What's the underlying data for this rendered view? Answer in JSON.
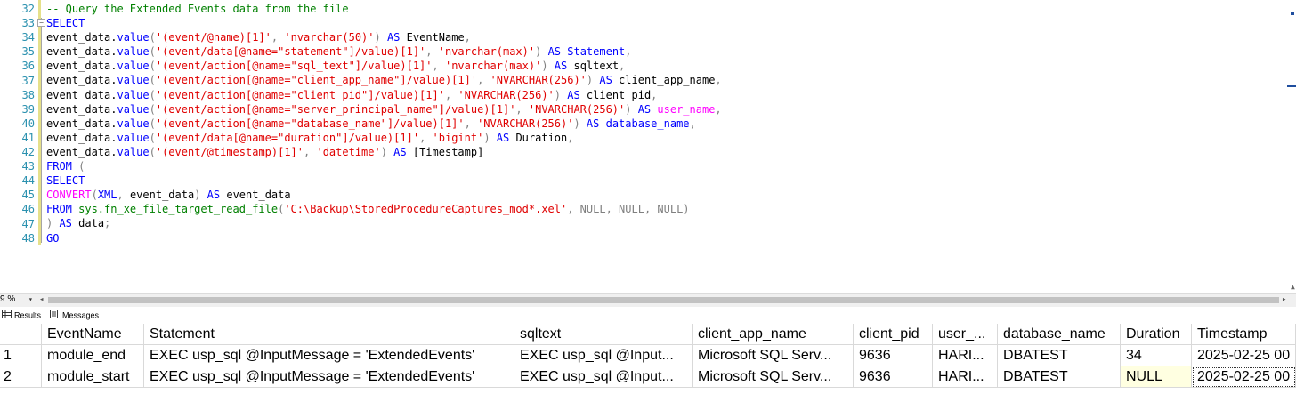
{
  "editor": {
    "line_numbers": [
      "32",
      "33",
      "34",
      "35",
      "36",
      "37",
      "38",
      "39",
      "40",
      "41",
      "42",
      "43",
      "44",
      "45",
      "46",
      "47",
      "48"
    ],
    "lines": [
      [
        {
          "t": "-- Query the Extended Events data from the file",
          "c": "cm"
        }
      ],
      [
        {
          "t": "SELECT",
          "c": "kw"
        }
      ],
      [
        {
          "t": "event_data.",
          "c": ""
        },
        {
          "t": "value",
          "c": "kw"
        },
        {
          "t": "(",
          "c": "gr"
        },
        {
          "t": "'(event/@name)[1]'",
          "c": "str"
        },
        {
          "t": ", ",
          "c": "gr"
        },
        {
          "t": "'nvarchar(50)'",
          "c": "str"
        },
        {
          "t": ")",
          "c": "gr"
        },
        {
          "t": " AS ",
          "c": "kw"
        },
        {
          "t": "EventName",
          "c": ""
        },
        {
          "t": ",",
          "c": "gr"
        }
      ],
      [
        {
          "t": "event_data.",
          "c": ""
        },
        {
          "t": "value",
          "c": "kw"
        },
        {
          "t": "(",
          "c": "gr"
        },
        {
          "t": "'(event/data[@name=\"statement\"]/value)[1]'",
          "c": "str"
        },
        {
          "t": ", ",
          "c": "gr"
        },
        {
          "t": "'nvarchar(max)'",
          "c": "str"
        },
        {
          "t": ")",
          "c": "gr"
        },
        {
          "t": " AS ",
          "c": "kw"
        },
        {
          "t": "Statement",
          "c": "kw"
        },
        {
          "t": ",",
          "c": "gr"
        }
      ],
      [
        {
          "t": "event_data.",
          "c": ""
        },
        {
          "t": "value",
          "c": "kw"
        },
        {
          "t": "(",
          "c": "gr"
        },
        {
          "t": "'(event/action[@name=\"sql_text\"]/value)[1]'",
          "c": "str"
        },
        {
          "t": ", ",
          "c": "gr"
        },
        {
          "t": "'nvarchar(max)'",
          "c": "str"
        },
        {
          "t": ")",
          "c": "gr"
        },
        {
          "t": " AS ",
          "c": "kw"
        },
        {
          "t": "sqltext",
          "c": ""
        },
        {
          "t": ",",
          "c": "gr"
        }
      ],
      [
        {
          "t": "event_data.",
          "c": ""
        },
        {
          "t": "value",
          "c": "kw"
        },
        {
          "t": "(",
          "c": "gr"
        },
        {
          "t": "'(event/action[@name=\"client_app_name\"]/value)[1]'",
          "c": "str"
        },
        {
          "t": ", ",
          "c": "gr"
        },
        {
          "t": "'NVARCHAR(256)'",
          "c": "str"
        },
        {
          "t": ")",
          "c": "gr"
        },
        {
          "t": " AS ",
          "c": "kw"
        },
        {
          "t": "client_app_name",
          "c": ""
        },
        {
          "t": ",",
          "c": "gr"
        }
      ],
      [
        {
          "t": "event_data.",
          "c": ""
        },
        {
          "t": "value",
          "c": "kw"
        },
        {
          "t": "(",
          "c": "gr"
        },
        {
          "t": "'(event/action[@name=\"client_pid\"]/value)[1]'",
          "c": "str"
        },
        {
          "t": ", ",
          "c": "gr"
        },
        {
          "t": "'NVARCHAR(256)'",
          "c": "str"
        },
        {
          "t": ")",
          "c": "gr"
        },
        {
          "t": " AS ",
          "c": "kw"
        },
        {
          "t": "client_pid",
          "c": ""
        },
        {
          "t": ",",
          "c": "gr"
        }
      ],
      [
        {
          "t": "event_data.",
          "c": ""
        },
        {
          "t": "value",
          "c": "kw"
        },
        {
          "t": "(",
          "c": "gr"
        },
        {
          "t": "'(event/action[@name=\"server_principal_name\"]/value)[1]'",
          "c": "str"
        },
        {
          "t": ", ",
          "c": "gr"
        },
        {
          "t": "'NVARCHAR(256)'",
          "c": "str"
        },
        {
          "t": ")",
          "c": "gr"
        },
        {
          "t": " AS ",
          "c": "kw"
        },
        {
          "t": "user_name",
          "c": "fn"
        },
        {
          "t": ",",
          "c": "gr"
        }
      ],
      [
        {
          "t": "event_data.",
          "c": ""
        },
        {
          "t": "value",
          "c": "kw"
        },
        {
          "t": "(",
          "c": "gr"
        },
        {
          "t": "'(event/action[@name=\"database_name\"]/value)[1]'",
          "c": "str"
        },
        {
          "t": ", ",
          "c": "gr"
        },
        {
          "t": "'NVARCHAR(256)'",
          "c": "str"
        },
        {
          "t": ")",
          "c": "gr"
        },
        {
          "t": " AS ",
          "c": "kw"
        },
        {
          "t": "database_name",
          "c": "kw"
        },
        {
          "t": ",",
          "c": "gr"
        }
      ],
      [
        {
          "t": "event_data.",
          "c": ""
        },
        {
          "t": "value",
          "c": "kw"
        },
        {
          "t": "(",
          "c": "gr"
        },
        {
          "t": "'(event/data[@name=\"duration\"]/value)[1]'",
          "c": "str"
        },
        {
          "t": ", ",
          "c": "gr"
        },
        {
          "t": "'bigint'",
          "c": "str"
        },
        {
          "t": ")",
          "c": "gr"
        },
        {
          "t": " AS ",
          "c": "kw"
        },
        {
          "t": "Duration",
          "c": ""
        },
        {
          "t": ",",
          "c": "gr"
        }
      ],
      [
        {
          "t": "event_data.",
          "c": ""
        },
        {
          "t": "value",
          "c": "kw"
        },
        {
          "t": "(",
          "c": "gr"
        },
        {
          "t": "'(event/@timestamp)[1]'",
          "c": "str"
        },
        {
          "t": ", ",
          "c": "gr"
        },
        {
          "t": "'datetime'",
          "c": "str"
        },
        {
          "t": ")",
          "c": "gr"
        },
        {
          "t": " AS ",
          "c": "kw"
        },
        {
          "t": "[Timestamp]",
          "c": ""
        }
      ],
      [
        {
          "t": "FROM",
          "c": "kw"
        },
        {
          "t": " (",
          "c": "gr"
        }
      ],
      [
        {
          "t": "SELECT",
          "c": "kw"
        }
      ],
      [
        {
          "t": "CONVERT",
          "c": "fn"
        },
        {
          "t": "(",
          "c": "gr"
        },
        {
          "t": "XML",
          "c": "kw"
        },
        {
          "t": ", ",
          "c": "gr"
        },
        {
          "t": "event_data",
          "c": ""
        },
        {
          "t": ")",
          "c": "gr"
        },
        {
          "t": " AS ",
          "c": "kw"
        },
        {
          "t": "event_data",
          "c": ""
        }
      ],
      [
        {
          "t": "FROM",
          "c": "kw"
        },
        {
          "t": " sys.fn_xe_file_target_read_file",
          "c": "sys"
        },
        {
          "t": "(",
          "c": "gr"
        },
        {
          "t": "'C:\\Backup\\StoredProcedureCaptures_mod*.xel'",
          "c": "str"
        },
        {
          "t": ", ",
          "c": "gr"
        },
        {
          "t": "NULL",
          "c": "gr"
        },
        {
          "t": ", ",
          "c": "gr"
        },
        {
          "t": "NULL",
          "c": "gr"
        },
        {
          "t": ", ",
          "c": "gr"
        },
        {
          "t": "NULL",
          "c": "gr"
        },
        {
          "t": ")",
          "c": "gr"
        }
      ],
      [
        {
          "t": ")",
          "c": "gr"
        },
        {
          "t": " AS ",
          "c": "kw"
        },
        {
          "t": "data",
          "c": ""
        },
        {
          "t": ";",
          "c": "gr"
        }
      ],
      [
        {
          "t": "GO",
          "c": "kw"
        }
      ]
    ],
    "zoom": "9 %"
  },
  "tabs": {
    "results": "Results",
    "messages": "Messages"
  },
  "grid": {
    "columns": [
      "EventName",
      "Statement",
      "sqltext",
      "client_app_name",
      "client_pid",
      "user_...",
      "database_name",
      "Duration",
      "Timestamp"
    ],
    "rows": [
      {
        "num": "1",
        "cells": [
          "module_end",
          "EXEC usp_sql @InputMessage = 'ExtendedEvents'",
          "EXEC usp_sql @Input...",
          "Microsoft SQL Serv...",
          "9636",
          "HARI...",
          "DBATEST",
          "34",
          "2025-02-25 00"
        ]
      },
      {
        "num": "2",
        "cells": [
          "module_start",
          "EXEC usp_sql @InputMessage = 'ExtendedEvents'",
          "EXEC usp_sql @Input...",
          "Microsoft SQL Serv...",
          "9636",
          "HARI...",
          "DBATEST",
          "NULL",
          "2025-02-25 00"
        ]
      }
    ]
  },
  "colors": {
    "keyword": "#0000ff",
    "string": "#e00000",
    "comment": "#008000",
    "function": "#ff00ff",
    "line_number": "#2b91af",
    "null_cell": "#ffffe1"
  }
}
